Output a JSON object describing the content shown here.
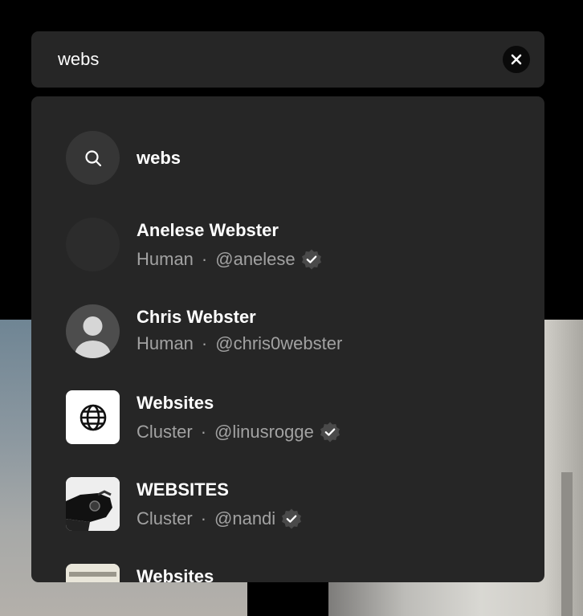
{
  "search": {
    "value": "webs",
    "placeholder": "Search"
  },
  "suggestion": {
    "query": "webs"
  },
  "results": [
    {
      "title": "Anelese Webster",
      "type": "Human",
      "handle": "@anelese",
      "verified": true
    },
    {
      "title": "Chris Webster",
      "type": "Human",
      "handle": "@chris0webster",
      "verified": false
    },
    {
      "title": "Websites",
      "type": "Cluster",
      "handle": "@linusrogge",
      "verified": true
    },
    {
      "title": "WEBSITES",
      "type": "Cluster",
      "handle": "@nandi",
      "verified": true
    },
    {
      "title": "Websites"
    }
  ],
  "separator": "·",
  "icons": {
    "clear": "close-icon",
    "search": "search-icon",
    "verified": "verified-badge-icon",
    "globe": "globe-icon",
    "default_avatar": "user-avatar-icon"
  },
  "colors": {
    "background": "#000000",
    "panel": "#262626",
    "text_primary": "#ffffff",
    "text_secondary": "#a2a2a2"
  }
}
